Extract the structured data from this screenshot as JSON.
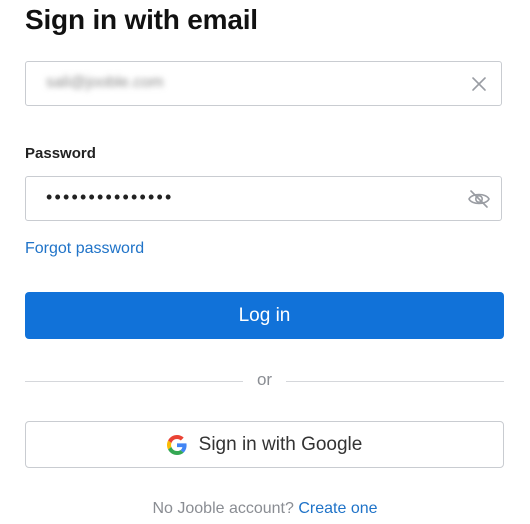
{
  "heading": "Sign in with email",
  "email": {
    "value": "sali@jooble.com"
  },
  "password": {
    "label": "Password",
    "value": "•••••••••••••••"
  },
  "forgot_password": "Forgot password",
  "login_button": "Log in",
  "divider": "or",
  "google_button": "Sign in with Google",
  "footer": {
    "text": "No Jooble account?",
    "link": "Create one"
  },
  "colors": {
    "primary": "#1172d9",
    "link": "#1f73c8",
    "muted": "#8a8d93",
    "border": "#c9ccd1"
  },
  "icons": [
    "clear-icon",
    "eye-slash-icon",
    "google-icon"
  ]
}
